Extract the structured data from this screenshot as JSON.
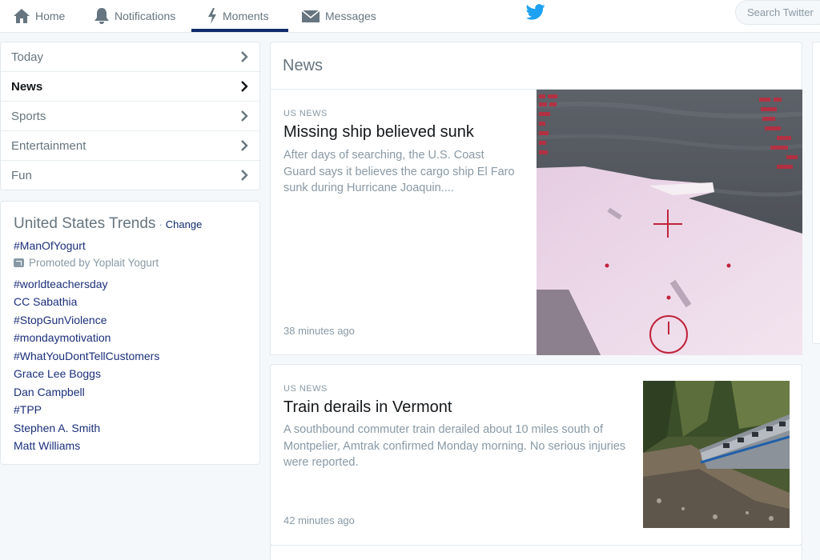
{
  "nav": {
    "home": "Home",
    "notifications": "Notifications",
    "moments": "Moments",
    "messages": "Messages",
    "search_placeholder": "Search Twitter"
  },
  "menu": {
    "items": [
      {
        "label": "Today"
      },
      {
        "label": "News"
      },
      {
        "label": "Sports"
      },
      {
        "label": "Entertainment"
      },
      {
        "label": "Fun"
      }
    ]
  },
  "trends": {
    "title": "United States Trends",
    "separator": "·",
    "change": "Change",
    "promoted_tag": "#ManOfYogurt",
    "promoted_by": "Promoted by Yoplait Yogurt",
    "items": [
      "#worldteachersday",
      "CC Sabathia",
      "#StopGunViolence",
      "#mondaymotivation",
      "#WhatYouDontTellCustomers",
      "Grace Lee Boggs",
      "Dan Campbell",
      "#TPP",
      "Stephen A. Smith",
      "Matt Williams"
    ]
  },
  "news": {
    "header": "News",
    "cards": [
      {
        "category": "US NEWS",
        "headline": "Missing ship believed sunk",
        "description": "After days of searching, the U.S. Coast Guard says it believes the cargo ship El Faro sunk during Hurricane Joaquin....",
        "time": "38 minutes ago"
      },
      {
        "category": "US NEWS",
        "headline": "Train derails in Vermont",
        "description": "A southbound commuter train derailed about 10 miles south of Montpelier, Amtrak confirmed Monday morning. No serious injuries were reported.",
        "time": "42 minutes ago"
      }
    ]
  },
  "colors": {
    "accent": "#0f2b6b",
    "twitter_blue": "#1da1f2",
    "muted": "#8899a6"
  }
}
